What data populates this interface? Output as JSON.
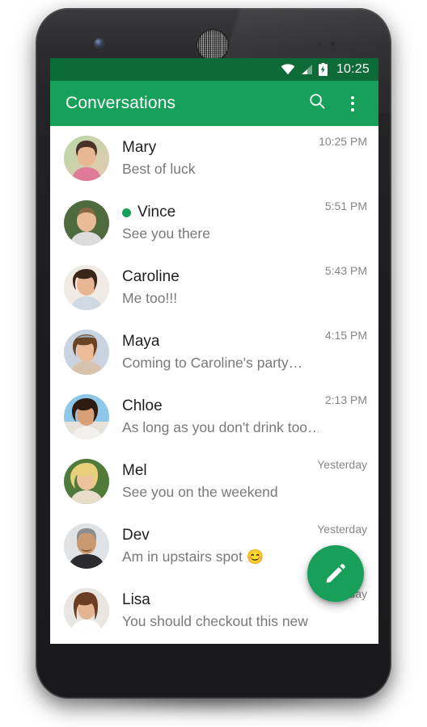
{
  "device": {
    "front_camera": "front-camera",
    "earpiece": "earpiece-speaker",
    "sensors": "proximity-sensors"
  },
  "status_bar": {
    "clock": "10:25",
    "wifi_icon": "wifi-icon",
    "signal_icon": "cell-signal-icon",
    "battery_icon": "battery-charging-icon",
    "background": "#0d6b38"
  },
  "app_bar": {
    "title": "Conversations",
    "search_icon": "search-icon",
    "overflow_icon": "overflow-menu-icon",
    "background": "#16a05a"
  },
  "fab": {
    "icon": "compose-pencil-icon",
    "color": "#18a05a"
  },
  "colors": {
    "accent": "#16a05a",
    "status_bar": "#0d6b38",
    "name_text": "#1f1f1f",
    "preview_text": "#797979",
    "time_text": "#858585",
    "online_dot": "#16a05a"
  },
  "conversations": [
    {
      "name": "Mary",
      "preview": "Best of luck",
      "time": "10:25 PM",
      "online": false,
      "avatar": "avatar-mary"
    },
    {
      "name": "Vince",
      "preview": "See you there",
      "time": "5:51 PM",
      "online": true,
      "avatar": "avatar-vince"
    },
    {
      "name": "Caroline",
      "preview": "Me too!!!",
      "time": "5:43 PM",
      "online": false,
      "avatar": "avatar-caroline"
    },
    {
      "name": "Maya",
      "preview": "Coming to Caroline's party…",
      "time": "4:15 PM",
      "online": false,
      "avatar": "avatar-maya"
    },
    {
      "name": "Chloe",
      "preview": "As long as you don't drink too…",
      "time": "2:13 PM",
      "online": false,
      "avatar": "avatar-chloe"
    },
    {
      "name": "Mel",
      "preview": "See you on the weekend",
      "time": "Yesterday",
      "online": false,
      "avatar": "avatar-mel"
    },
    {
      "name": "Dev",
      "preview": "Am in upstairs spot 😊",
      "time": "Yesterday",
      "online": false,
      "avatar": "avatar-dev"
    },
    {
      "name": "Lisa",
      "preview": "You should checkout this new club",
      "time": "Yesterday",
      "online": false,
      "avatar": "avatar-lisa"
    }
  ]
}
